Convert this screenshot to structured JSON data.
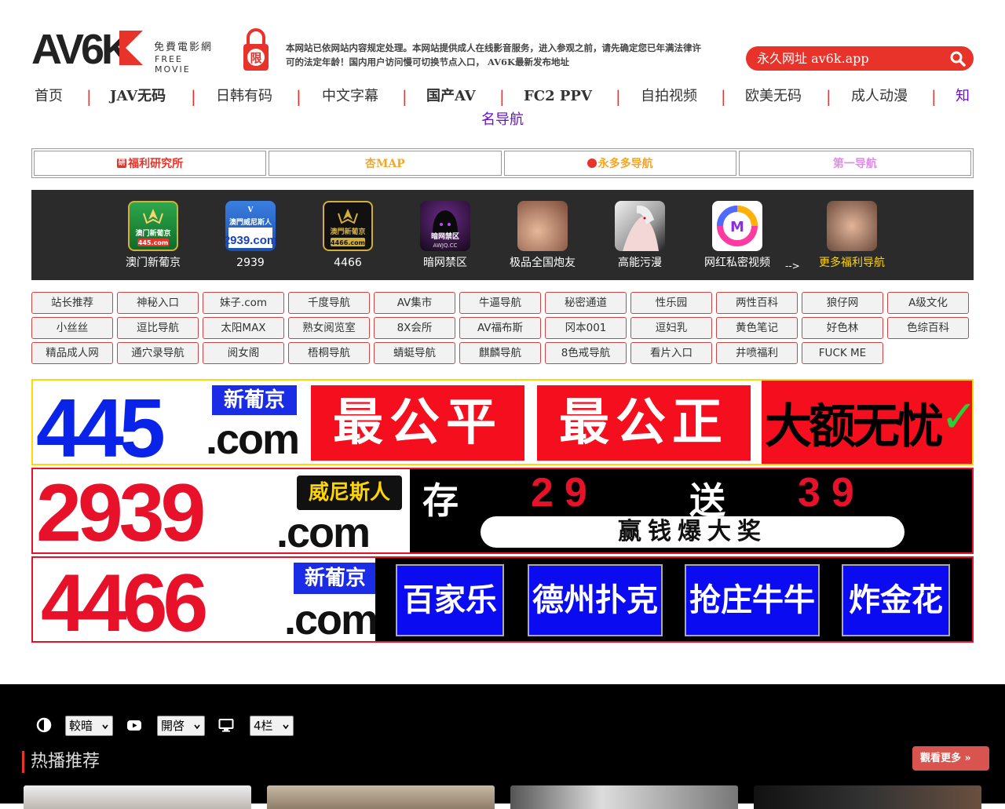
{
  "header": {
    "logo_text": "AV6K",
    "logo_sub_cn": "免費電影網",
    "logo_sub_en": "FREE MOVIE",
    "lock_char": "限",
    "notice": "本网站已依网站内容规定处理。本网站提供成人在线影音服务，进入参观之前，请先确定您已年满法律许可的法定年龄！国内用户访问慢可切换节点入口，",
    "notice_tail": "AV6K最新发布地址",
    "search_placeholder": "永久网址 av6k.app"
  },
  "nav": {
    "items": [
      "首页",
      "JAV无码",
      "日韩有码",
      "中文字幕",
      "国产AV",
      "FC2 PPV",
      "自拍视频",
      "欧美无码",
      "成人动漫"
    ],
    "special_start": "知",
    "special_end": "名导航",
    "separator": "|"
  },
  "subnav": [
    {
      "label": "福利研究所",
      "color": "#e8332b",
      "icon": "研"
    },
    {
      "label": "杏MAP",
      "color": "#f5a623",
      "icon": ""
    },
    {
      "label": "永多多导航",
      "color": "#f5a623",
      "icon": "badge"
    },
    {
      "label": "第一导航",
      "color": "#e28ae8",
      "icon": ""
    }
  ],
  "apps": [
    {
      "label": "澳门新葡京",
      "icon_text": "445.com",
      "icon_title": "澳门新葡京",
      "bg": "#1d8a3a",
      "style": "green"
    },
    {
      "label": "2939",
      "icon_text": "2939.com",
      "icon_title": "澳門威尼斯人",
      "bg": "#1a60c9",
      "style": "blue"
    },
    {
      "label": "4466",
      "icon_text": "4466.com",
      "icon_title": "澳門新葡京",
      "bg": "#1a1a1a",
      "style": "gold"
    },
    {
      "label": "暗网禁区",
      "icon_text": "AWJQ.CC",
      "icon_title": "暗网禁区",
      "bg": "#2a0a3a",
      "style": "dark"
    },
    {
      "label": "极品全国炮友",
      "icon_text": "",
      "icon_title": "",
      "bg": "#c99a7a",
      "style": "photo"
    },
    {
      "label": "高能污漫",
      "icon_text": "",
      "icon_title": "",
      "bg": "#d9d9d9",
      "style": "anime"
    },
    {
      "label": "网红私密视频",
      "icon_text": "",
      "icon_title": "",
      "bg": "#ffffff",
      "style": "logo"
    },
    {
      "label": "更多福利导航",
      "icon_text": "",
      "icon_title": "",
      "bg": "#b88a6a",
      "style": "photo2"
    }
  ],
  "apps_arrow": "-->",
  "links": [
    [
      "站长推荐",
      "神秘入口",
      "妹子.com",
      "千度导航",
      "AV集市",
      "牛逼导航",
      "秘密通道",
      "性乐园",
      "两性百科",
      "狼仔网",
      "A级文化"
    ],
    [
      "小丝丝",
      "逗比导航",
      "太阳MAX",
      "熟女阅览室",
      "8X会所",
      "AV福布斯",
      "冈本001",
      "逗妇乳",
      "黄色笔记",
      "好色林",
      "色综百科"
    ],
    [
      "精品成人网",
      "通穴录导航",
      "阅女阁",
      "梧桐导航",
      "蜻蜓导航",
      "麒麟导航",
      "8色戒导航",
      "看片入口",
      "井喷福利",
      "FUCK ME"
    ]
  ],
  "banners": {
    "b1": {
      "num": "445",
      "tag": "新葡京",
      "dotcom": ".com",
      "blocks": [
        "最公平",
        "最公正"
      ],
      "slogan": "大额无忧",
      "check": "✓"
    },
    "b2": {
      "num": "2939",
      "tag": "威尼斯人",
      "dotcom": ".com",
      "promo_top_a": "存",
      "promo_top_b": "29",
      "promo_top_c": "送",
      "promo_top_d": "39",
      "promo_bottom": "赢钱爆大奖"
    },
    "b3": {
      "num": "4466",
      "tag": "新葡京",
      "dotcom": ".com",
      "games": [
        "百家乐",
        "德州扑克",
        "抢庄牛牛",
        "炸金花"
      ]
    }
  },
  "controls": {
    "theme_value": "較暗",
    "autoplay_value": "開啓",
    "columns_value": "4栏"
  },
  "section": {
    "title": "热播推荐",
    "more_label": "觀看更多 »"
  },
  "colors": {
    "accent": "#e8332b",
    "nav_special": "#6a11cb",
    "app_bg": "#2b2b2b",
    "dark_bg": "#000000"
  }
}
